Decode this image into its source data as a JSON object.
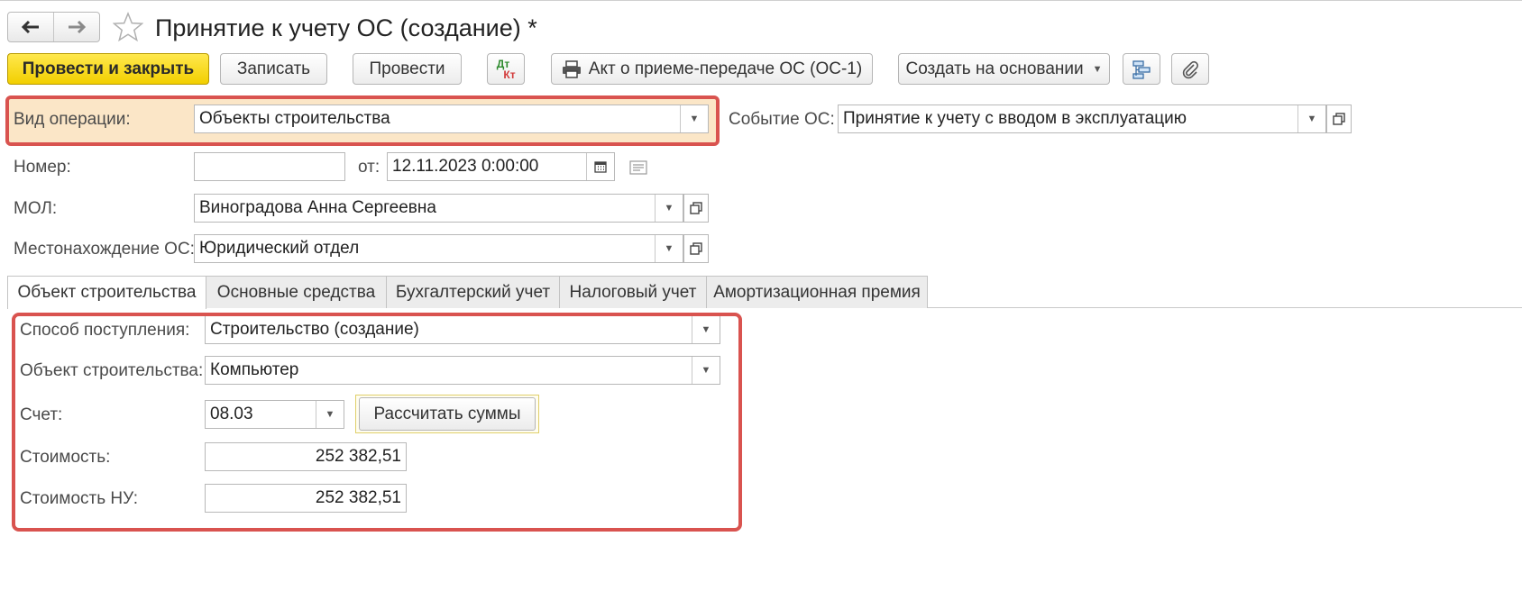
{
  "window": {
    "title": "Принятие к учету ОС (создание) *"
  },
  "toolbar": {
    "post_close": "Провести и закрыть",
    "save": "Записать",
    "post": "Провести",
    "dtkt_top": "Дт",
    "dtkt_bottom": "Кт",
    "act": "Акт о приеме-передаче ОС (ОС-1)",
    "create_based": "Создать на основании"
  },
  "form": {
    "operation_label": "Вид операции:",
    "operation_value": "Объекты строительства",
    "event_label": "Событие ОС:",
    "event_value": "Принятие к учету с вводом в эксплуатацию",
    "number_label": "Номер:",
    "number_value": "",
    "date_label": "от:",
    "date_value": "12.11.2023  0:00:00",
    "mol_label": "МОЛ:",
    "mol_value": "Виноградова Анна Сергеевна",
    "location_label": "Местонахождение ОС:",
    "location_value": "Юридический отдел"
  },
  "tabs": [
    {
      "label": "Объект строительства",
      "active": true
    },
    {
      "label": "Основные средства",
      "active": false
    },
    {
      "label": "Бухгалтерский учет",
      "active": false
    },
    {
      "label": "Налоговый учет",
      "active": false
    },
    {
      "label": "Амортизационная премия",
      "active": false
    }
  ],
  "tab_content": {
    "method_label": "Способ поступления:",
    "method_value": "Строительство (создание)",
    "object_label": "Объект строительства:",
    "object_value": "Компьютер",
    "account_label": "Счет:",
    "account_value": "08.03",
    "calc_button": "Рассчитать суммы",
    "cost_label": "Стоимость:",
    "cost_value": "252 382,51",
    "cost_nu_label": "Стоимость НУ:",
    "cost_nu_value": "252 382,51"
  },
  "colors": {
    "primary_button": "#f2cf00",
    "highlight_border": "#d9534f",
    "operation_background": "#fbe6c7"
  }
}
